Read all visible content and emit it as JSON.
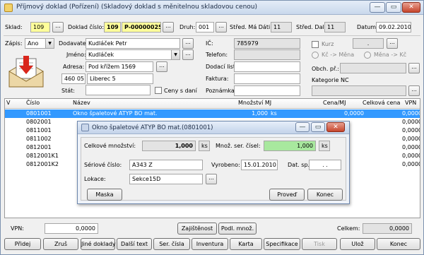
{
  "window": {
    "title": "Příjmový doklad (Pořízení) (Skladový doklad s měnitelnou skladovou cenou)",
    "minimize": "—",
    "maximize": "▭",
    "close": "✕"
  },
  "header": {
    "sklad_label": "Sklad:",
    "sklad_value": "109",
    "doklad_label": "Doklad číslo:",
    "doklad_prefix": "109",
    "doklad_number": "P-00000025",
    "druh_label": "Druh:",
    "druh_value": "001",
    "stred_ma_dati_label": "Střed. Má Dáti:",
    "stred_ma_dati_value": "11",
    "stred_dal_label": "Střed. Dal:",
    "stred_dal_value": "11",
    "datum_label": "Datum:",
    "datum_value": "09.02.2010",
    "dots": "..."
  },
  "partner": {
    "zapis_label": "Zápis:",
    "zapis_value": "Ano",
    "dodavatel_label": "Dodavatel:",
    "dodavatel_value": "Kudláček Petr",
    "jmeno_label": "Jméno:",
    "jmeno_value": "Kudláček",
    "adresa_label": "Adresa:",
    "adresa_value": "Pod křížem 1569",
    "psc_value": "460 05",
    "mesto_value": "Liberec 5",
    "stat_label": "Stát:",
    "ceny_s_dani_label": "Ceny s daní"
  },
  "middle": {
    "ic_label": "IČ:",
    "ic_value": "785979",
    "telefon_label": "Telefon:",
    "dodaci_list_label": "Dodací list:",
    "faktura_label": "Faktura:",
    "poznamka_label": "Poznámka:"
  },
  "right": {
    "kurz_label": "Kurz",
    "kurz_value": ".",
    "kc_mena_label": "Kč -> Měna",
    "mena_kc_label": "Měna -> Kč",
    "obch_pr_label": "Obch. př.:",
    "kategorie_label": "Kategorie NC"
  },
  "table": {
    "columns": [
      "V",
      "Číslo",
      "Název",
      "Množství MJ",
      "Cena/MJ",
      "Celková cena",
      "VPN"
    ],
    "rows": [
      {
        "cislo": "0801001",
        "nazev": "Okno špaletové ATYP BO mat.",
        "mnozstvi": "1,000",
        "mj": "ks",
        "cena": "0,0000",
        "celkem": "0,0000",
        "selected": true
      },
      {
        "cislo": "0802001",
        "nazev": "",
        "mnozstvi": "",
        "mj": "",
        "cena": "",
        "celkem": "0,0000",
        "selected": false
      },
      {
        "cislo": "0811001",
        "nazev": "",
        "mnozstvi": "",
        "mj": "",
        "cena": "",
        "celkem": "0,0000",
        "selected": false
      },
      {
        "cislo": "0811002",
        "nazev": "",
        "mnozstvi": "",
        "mj": "",
        "cena": "",
        "celkem": "0,0000",
        "selected": false
      },
      {
        "cislo": "0812001",
        "nazev": "",
        "mnozstvi": "",
        "mj": "",
        "cena": "",
        "celkem": "0,0000",
        "selected": false
      },
      {
        "cislo": "0812001K1",
        "nazev": "",
        "mnozstvi": "",
        "mj": "",
        "cena": "",
        "celkem": "0,0000",
        "selected": false
      },
      {
        "cislo": "0812001K2",
        "nazev": "",
        "mnozstvi": "",
        "mj": "",
        "cena": "",
        "celkem": "0,0000",
        "selected": false
      }
    ]
  },
  "dialog": {
    "title": "Okno špaletové ATYP BO mat.(0801001)",
    "celkove_mnozstvi_label": "Celkové množství:",
    "celkove_mnozstvi_value": "1,000",
    "celkove_mj": "ks",
    "mnoz_ser_label": "Množ. ser. čísel:",
    "mnoz_ser_value": "1,000",
    "mnoz_ser_mj": "ks",
    "seriove_cislo_label": "Sériové číslo:",
    "seriove_cislo_value": "A343 Z",
    "vyrobeno_label": "Vyrobeno:",
    "vyrobeno_value": "15.01.2010",
    "dat_sp_label": "Dat. sp.:",
    "dat_sp_value": ". .",
    "lokace_label": "Lokace:",
    "lokace_value": "Sekce15D",
    "maska_button": "Maska",
    "proved_button": "Proveď",
    "konec_button": "Konec"
  },
  "footer": {
    "vpn_label": "VPN:",
    "vpn_value": "0,0000",
    "zajistenost_button": "Zajištěnost",
    "podl_mnoz_button": "Podl. množ.",
    "celkem_label": "Celkem:",
    "celkem_value": "0,0000"
  },
  "toolbar": {
    "buttons": [
      "Přidej",
      "Zruš",
      "Jiné doklady",
      "Další text",
      "Ser. čísla",
      "Inventura",
      "Karta",
      "Specifikace",
      "Tisk",
      "Ulož",
      "Konec"
    ]
  },
  "colors": {
    "selection": "#3399ff",
    "required_yellow": "#ffff9a",
    "ok_green": "#a8e89e"
  }
}
